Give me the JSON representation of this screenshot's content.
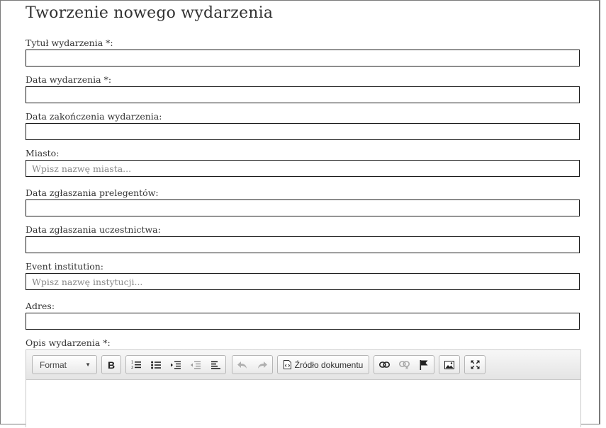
{
  "page": {
    "title": "Tworzenie nowego wydarzenia"
  },
  "fields": [
    {
      "label": "Tytuł wydarzenia *:",
      "value": "",
      "placeholder": ""
    },
    {
      "label": "Data wydarzenia *:",
      "value": "",
      "placeholder": ""
    },
    {
      "label": "Data zakończenia wydarzenia:",
      "value": "",
      "placeholder": ""
    },
    {
      "label": "Miasto:",
      "value": "",
      "placeholder": "Wpisz nazwę miasta..."
    },
    {
      "label": "Data zgłaszania prelegentów:",
      "value": "",
      "placeholder": ""
    },
    {
      "label": "Data zgłaszania uczestnictwa:",
      "value": "",
      "placeholder": ""
    },
    {
      "label": "Event institution:",
      "value": "",
      "placeholder": "Wpisz nazwę instytucji..."
    },
    {
      "label": "Adres:",
      "value": "",
      "placeholder": ""
    }
  ],
  "editor": {
    "label": "Opis wydarzenia *:",
    "format_label": "Format",
    "bold_label": "B",
    "source_label": "Źródło dokumentu",
    "icons": [
      "chevron-down-icon",
      "numbered-list-icon",
      "bulleted-list-icon",
      "indent-icon",
      "outdent-icon",
      "align-left-icon",
      "undo-icon",
      "redo-icon",
      "source-icon",
      "link-icon",
      "unlink-icon",
      "anchor-flag-icon",
      "image-icon",
      "maximize-icon"
    ]
  }
}
